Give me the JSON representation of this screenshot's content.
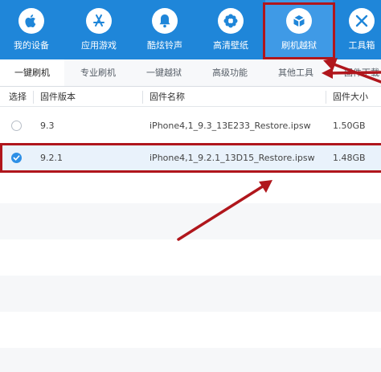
{
  "nav": {
    "items": [
      {
        "label": "我的设备",
        "icon": "apple-icon"
      },
      {
        "label": "应用游戏",
        "icon": "app-store-icon"
      },
      {
        "label": "酷炫铃声",
        "icon": "bell-icon"
      },
      {
        "label": "高清壁纸",
        "icon": "flower-icon"
      },
      {
        "label": "刷机越狱",
        "icon": "box-icon"
      },
      {
        "label": "工具箱",
        "icon": "tools-icon"
      }
    ],
    "active_index": 4,
    "bar_color": "#1f86d9"
  },
  "subtabs": {
    "items": [
      "一键刷机",
      "专业刷机",
      "一键越狱",
      "高级功能",
      "其他工具",
      "固件下载"
    ],
    "active_index": 0
  },
  "table": {
    "headers": {
      "select": "选择",
      "version": "固件版本",
      "name": "固件名称",
      "size": "固件大小"
    },
    "rows": [
      {
        "version": "9.3",
        "name": "iPhone4,1_9.3_13E233_Restore.ipsw",
        "size": "1.50GB",
        "selected": false
      },
      {
        "version": "9.2.1",
        "name": "iPhone4,1_9.2.1_13D15_Restore.ipsw",
        "size": "1.48GB",
        "selected": true
      }
    ]
  },
  "annotation_color": "#b0161c",
  "accent_color": "#2d8fe6"
}
